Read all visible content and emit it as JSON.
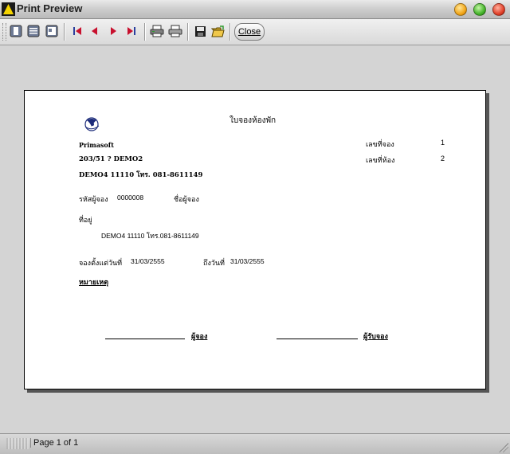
{
  "window": {
    "title": "Print Preview"
  },
  "toolbar": {
    "buttons": [
      {
        "name": "one-page-view-icon",
        "glyph": "▣"
      },
      {
        "name": "two-page-view-icon",
        "glyph": "▤"
      },
      {
        "name": "page-width-icon",
        "glyph": "▥"
      },
      {
        "name": "first-page-icon",
        "glyph": "⏮"
      },
      {
        "name": "previous-page-icon",
        "glyph": "◀"
      },
      {
        "name": "next-page-icon",
        "glyph": "▶"
      },
      {
        "name": "last-page-icon",
        "glyph": "⏭"
      },
      {
        "name": "print-setup-icon",
        "glyph": "🖨"
      },
      {
        "name": "print-icon",
        "glyph": "🖨"
      },
      {
        "name": "save-icon",
        "glyph": "💾"
      },
      {
        "name": "open-folder-icon",
        "glyph": "📂"
      }
    ],
    "close_label": "Close"
  },
  "document": {
    "title": "ใบจองห้องพัก",
    "company": "Primasoft",
    "address_line1": "203/51 ? DEMO2",
    "address_line2": "DEMO4 11110 โทร. 081-8611149",
    "booking_no_label": "เลขที่จอง",
    "booking_no_value": "1",
    "room_no_label": "เลขที่ห้อง",
    "room_no_value": "2",
    "booker_code_label": "รหัสผู้จอง",
    "booker_code_value": "0000008",
    "booker_name_label": "ชื่อผู้จอง",
    "address_label": "ที่อยู่",
    "address_value": "DEMO4 11110 โทร.081-8611149",
    "from_date_label": "จองตั้งแต่วันที่",
    "from_date_value": "31/03/2555",
    "to_date_label": "ถึงวันที่",
    "to_date_value": "31/03/2555",
    "remarks_label": "หมายเหตุ",
    "signer_label": "ผู้จอง",
    "receiver_label": "ผู้รับจอง"
  },
  "status": {
    "page_text": "Page 1 of 1"
  },
  "colors": {
    "paper": "#ffffff",
    "background": "#d4d4d4"
  }
}
